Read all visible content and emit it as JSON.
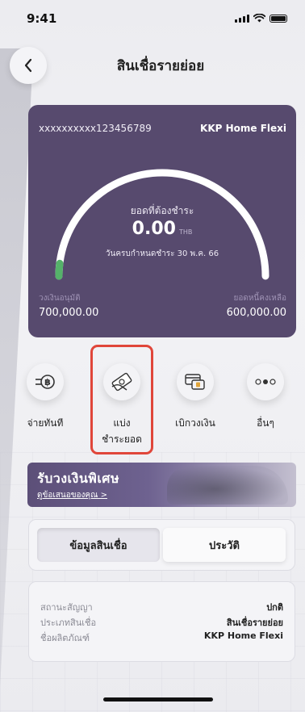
{
  "status_bar": {
    "time": "9:41"
  },
  "header": {
    "title": "สินเชื่อรายย่อย"
  },
  "account_card": {
    "account_number": "xxxxxxxxxx123456789",
    "product_name": "KKP Home Flexi",
    "due_label": "ยอดที่ต้องชำระ",
    "due_amount": "0.00",
    "due_currency": "THB",
    "due_date": "วันครบกำหนดชำระ 30 พ.ค. 66",
    "credit_limit_label": "วงเงินอนุมัติ",
    "credit_limit_value": "700,000.00",
    "outstanding_label": "ยอดหนี้คงเหลือ",
    "outstanding_value": "600,000.00",
    "gauge_fill_fraction": 0.02
  },
  "actions": [
    {
      "label": "จ่ายทันที",
      "icon": "pay-baht-icon"
    },
    {
      "label": "แบ่ง\nชำระยอด",
      "icon": "split-payment-icon"
    },
    {
      "label": "เบิกวงเงิน",
      "icon": "withdraw-card-icon"
    },
    {
      "label": "อื่นๆ",
      "icon": "more-dots-icon"
    }
  ],
  "promo": {
    "title": "รับวงเงินพิเศษ",
    "link": "ดูข้อเสนอของคุณ >"
  },
  "tabs": [
    {
      "label": "ข้อมูลสินเชื่อ",
      "active": true
    },
    {
      "label": "ประวัติ",
      "active": false
    }
  ],
  "info": {
    "rows": [
      {
        "label": "สถานะสัญญา",
        "value": "ปกติ"
      },
      {
        "label": "ประเภทสินเชื่อ",
        "value": "สินเชื่อรายย่อย"
      },
      {
        "label": "ชื่อผลิตภัณฑ์",
        "value": "KKP Home Flexi"
      }
    ]
  },
  "colors": {
    "card_bg": "#574a6e",
    "gauge_fill": "#55b26a",
    "highlight": "#e0463a"
  }
}
